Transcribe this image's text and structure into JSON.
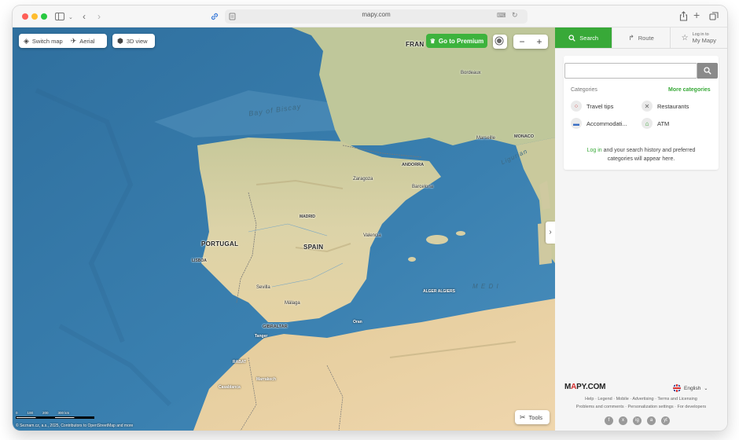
{
  "browser": {
    "url": "mapy.com"
  },
  "map_controls": {
    "switch_map": "Switch map",
    "aerial": "Aerial",
    "view_3d": "3D view",
    "premium": "Go to Premium",
    "zoom_out": "−",
    "zoom_in": "+",
    "tools": "Tools",
    "collapse": "›"
  },
  "map_labels": {
    "portugal": "PORTUGAL",
    "spain": "SPAIN",
    "andorra": "ANDORRA",
    "monaco": "MONACO",
    "gibraltar": "GIBRALTAR",
    "france_partial": "FRAN",
    "bay_of_biscay": "Bay of Biscay",
    "ligurian": "Ligurian",
    "medi_partial": "M E D I",
    "lisboa": "LISBOA",
    "madrid": "MADRID",
    "sevilla": "Sevilla",
    "malaga": "Málaga",
    "valencia": "Valencia",
    "barcelona": "Barcelona",
    "bordeaux": "Bordeaux",
    "marseille": "Marseille",
    "zaragoza": "Zaragoza",
    "alger": "ALGER ALGIERS",
    "oran": "Oran",
    "rabat": "RABAT",
    "tanger": "Tanger",
    "casablanca": "Casablanca",
    "marrakech": "Marrakech"
  },
  "scalebar": {
    "labels": [
      "0",
      "100",
      "200",
      "300 km"
    ]
  },
  "attribution": "© Seznam.cz, a.s., 2025, Contributors to OpenStreetMap and more",
  "panel": {
    "tabs": {
      "search": "Search",
      "route": "Route",
      "login_line1": "Log in to",
      "login_line2": "My Mapy"
    },
    "search_placeholder": "",
    "categories_title": "Categories",
    "more_categories": "More categories",
    "categories": [
      {
        "label": "Travel tips",
        "icon": "travel-tips-icon"
      },
      {
        "label": "Restaurants",
        "icon": "restaurant-icon"
      },
      {
        "label": "Accommodati...",
        "icon": "bed-icon"
      },
      {
        "label": "ATM",
        "icon": "atm-icon"
      }
    ],
    "login_link": "Log in",
    "login_rest_line1": " and your search history and preferred",
    "login_rest_line2": "categories will appear here.",
    "footer": {
      "logo_main": "M",
      "logo_accent": "A",
      "logo_rest": "PY.COM",
      "language": "English",
      "links_line1": "Help · Legend · Mobile · Advertising · Terms and Licensing",
      "links_line2": "Problems and comments · Personalization settings · For developers",
      "socials": [
        "f",
        "x",
        "ig",
        "a",
        "yt"
      ]
    }
  },
  "colors": {
    "accent_green": "#38a938",
    "sea": "#3a7fae",
    "land": "#d8d2a8"
  }
}
